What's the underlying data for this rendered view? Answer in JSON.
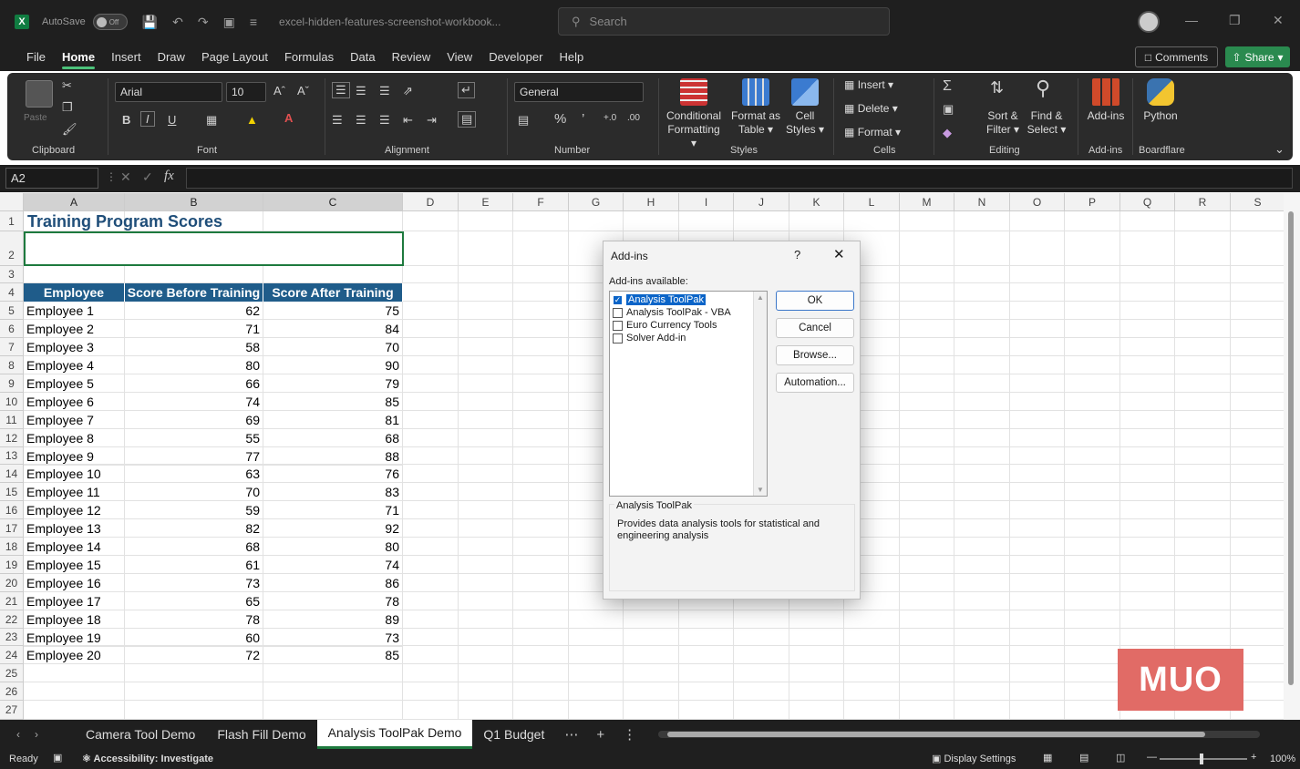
{
  "titlebar": {
    "autosave_label": "AutoSave",
    "autosave_state": "Off",
    "filename": "excel-hidden-features-screenshot-workbook...",
    "search_placeholder": "Search"
  },
  "menu": [
    "File",
    "Home",
    "Insert",
    "Draw",
    "Page Layout",
    "Formulas",
    "Data",
    "Review",
    "View",
    "Developer",
    "Help"
  ],
  "active_menu": "Home",
  "top_right": {
    "comments": "Comments",
    "share": "Share"
  },
  "ribbon": {
    "clipboard": {
      "label": "Clipboard",
      "paste": "Paste"
    },
    "font": {
      "label": "Font",
      "font_name": "Arial",
      "font_size": "10"
    },
    "alignment": {
      "label": "Alignment"
    },
    "number": {
      "label": "Number",
      "format": "General"
    },
    "styles": {
      "label": "Styles",
      "conditional": "Conditional",
      "conditional2": "Formatting",
      "format_as": "Format as",
      "format_as2": "Table",
      "cell": "Cell",
      "cell2": "Styles"
    },
    "cells": {
      "label": "Cells",
      "insert": "Insert",
      "delete": "Delete",
      "format": "Format"
    },
    "editing": {
      "label": "Editing",
      "sort": "Sort &",
      "sort2": "Filter",
      "find": "Find &",
      "find2": "Select"
    },
    "addins": {
      "label": "Add-ins",
      "btn": "Add-ins"
    },
    "boardflare": {
      "label": "Boardflare",
      "btn": "Python"
    }
  },
  "formula_bar": {
    "name_box": "A2",
    "fx": "fx"
  },
  "sheet": {
    "columns": [
      "A",
      "B",
      "C",
      "D",
      "E",
      "F",
      "G",
      "H",
      "I",
      "J",
      "K",
      "L",
      "M",
      "N",
      "O",
      "P",
      "Q",
      "R",
      "S"
    ],
    "title": "Training Program Scores",
    "headers": [
      "Employee",
      "Score Before Training",
      "Score After Training"
    ],
    "rows": [
      [
        "Employee 1",
        "62",
        "75"
      ],
      [
        "Employee 2",
        "71",
        "84"
      ],
      [
        "Employee 3",
        "58",
        "70"
      ],
      [
        "Employee 4",
        "80",
        "90"
      ],
      [
        "Employee 5",
        "66",
        "79"
      ],
      [
        "Employee 6",
        "74",
        "85"
      ],
      [
        "Employee 7",
        "69",
        "81"
      ],
      [
        "Employee 8",
        "55",
        "68"
      ],
      [
        "Employee 9",
        "77",
        "88"
      ],
      [
        "Employee 10",
        "63",
        "76"
      ],
      [
        "Employee 11",
        "70",
        "83"
      ],
      [
        "Employee 12",
        "59",
        "71"
      ],
      [
        "Employee 13",
        "82",
        "92"
      ],
      [
        "Employee 14",
        "68",
        "80"
      ],
      [
        "Employee 15",
        "61",
        "74"
      ],
      [
        "Employee 16",
        "73",
        "86"
      ],
      [
        "Employee 17",
        "65",
        "78"
      ],
      [
        "Employee 18",
        "78",
        "89"
      ],
      [
        "Employee 19",
        "60",
        "73"
      ],
      [
        "Employee 20",
        "72",
        "85"
      ]
    ]
  },
  "dialog": {
    "title": "Add-ins",
    "help": "?",
    "available_label": "Add-ins available:",
    "items": [
      {
        "label": "Analysis ToolPak",
        "checked": true,
        "selected": true
      },
      {
        "label": "Analysis ToolPak - VBA",
        "checked": false,
        "selected": false
      },
      {
        "label": "Euro Currency Tools",
        "checked": false,
        "selected": false
      },
      {
        "label": "Solver Add-in",
        "checked": false,
        "selected": false
      }
    ],
    "buttons": {
      "ok": "OK",
      "cancel": "Cancel",
      "browse": "Browse...",
      "automation": "Automation..."
    },
    "desc_title": "Analysis ToolPak",
    "desc_text": "Provides data analysis tools for statistical and engineering analysis"
  },
  "tabs": [
    "Camera Tool Demo",
    "Flash Fill Demo",
    "Analysis ToolPak Demo",
    "Q1 Budget"
  ],
  "active_tab": "Analysis ToolPak Demo",
  "status": {
    "ready": "Ready",
    "accessibility": "Accessibility: Investigate",
    "display": "Display Settings",
    "zoom": "100%"
  },
  "watermark": "MUO"
}
